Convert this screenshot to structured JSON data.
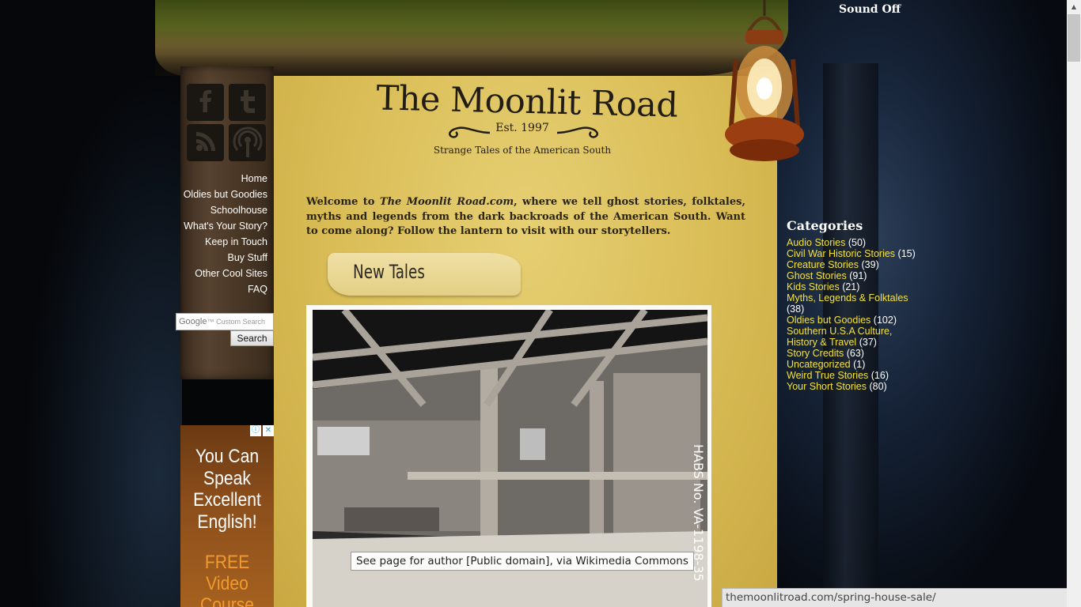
{
  "header": {
    "title": "The Moonlit Road",
    "established": "Est. 1997",
    "tagline": "Strange Tales of the American South",
    "sound_toggle": "Sound Off"
  },
  "social": [
    {
      "icon": "facebook-icon"
    },
    {
      "icon": "twitter-icon"
    },
    {
      "icon": "rss-icon"
    },
    {
      "icon": "podcast-icon"
    }
  ],
  "nav": {
    "items": [
      "Home",
      "Oldies but Goodies",
      "Schoolhouse",
      "What's Your Story?",
      "Keep in Touch",
      "Buy Stuff",
      "Other Cool Sites",
      "FAQ"
    ]
  },
  "search": {
    "placeholder": "Custom Search",
    "brand": "Google",
    "button_label": "Search"
  },
  "ad": {
    "headline": "You Can Speak Excellent English!",
    "sub": "FREE Video Course"
  },
  "welcome": {
    "prefix": "Welcome to ",
    "site": "The Moonlit Road.com",
    "rest": ", where we tell ghost stories, folktales, myths and legends from the dark backroads of the American South. Want to come along? Follow the lantern to visit with our storytellers."
  },
  "section": {
    "new_tales": "New Tales"
  },
  "photo": {
    "caption": "See page for author [Public domain], via Wikimedia Commons",
    "stamp": "HABS No. VA-1198-35"
  },
  "categories": {
    "heading": "Categories",
    "items": [
      {
        "name": "Audio Stories",
        "count": "(50)"
      },
      {
        "name": "Civil War Historic Stories",
        "count": "(15)"
      },
      {
        "name": "Creature Stories",
        "count": "(39)"
      },
      {
        "name": "Ghost Stories",
        "count": "(91)"
      },
      {
        "name": "Kids Stories",
        "count": "(21)"
      },
      {
        "name": "Myths, Legends & Folktales",
        "count": "(38)"
      },
      {
        "name": "Oldies but Goodies",
        "count": "(102)"
      },
      {
        "name": "Southern U.S.A Culture, History & Travel",
        "count": "(37)"
      },
      {
        "name": "Story Credits",
        "count": "(63)"
      },
      {
        "name": "Uncategorized",
        "count": "(1)"
      },
      {
        "name": "Weird True Stories",
        "count": "(16)"
      },
      {
        "name": "Your Short Stories",
        "count": "(80)"
      }
    ]
  },
  "status_bar": {
    "url": "themoonlitroad.com/spring-house-sale/"
  },
  "colors": {
    "parchment": "#d9bc55",
    "category_link": "#f4e23c",
    "ad_accent": "#f29a2e"
  }
}
